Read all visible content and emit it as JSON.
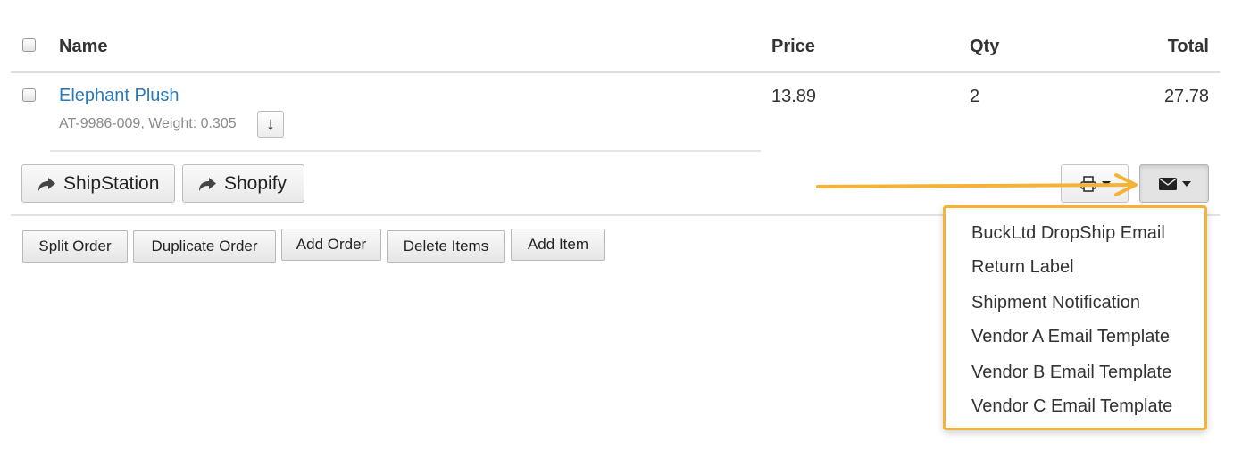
{
  "table": {
    "headers": {
      "name": "Name",
      "price": "Price",
      "qty": "Qty",
      "total": "Total"
    },
    "item": {
      "name": "Elephant Plush",
      "meta": "AT-9986-009, Weight: 0.305",
      "sort_glyph": "↓",
      "price": "13.89",
      "qty": "2",
      "total": "27.78"
    }
  },
  "export_buttons": {
    "shipstation": "ShipStation",
    "shopify": "Shopify"
  },
  "actions": {
    "split_order": "Split Order",
    "duplicate_order": "Duplicate Order",
    "add_order": "Add Order",
    "delete_items": "Delete Items",
    "add_item": "Add Item"
  },
  "icons": {
    "print": "printer-icon",
    "email": "envelope-icon",
    "share": "share-arrow-icon"
  },
  "email_menu": {
    "items": [
      "BuckLtd DropShip Email",
      "Return Label",
      "Shipment Notification",
      "Vendor A Email Template",
      "Vendor B Email Template",
      "Vendor C Email Template"
    ]
  },
  "colors": {
    "link": "#2a7ab8",
    "annotation": "#f5b233"
  }
}
